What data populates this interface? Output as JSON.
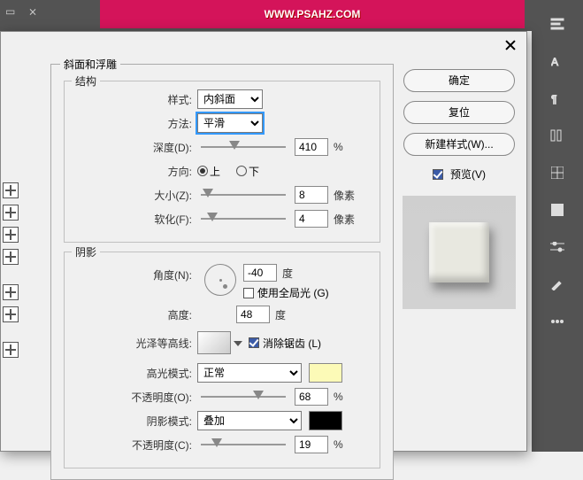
{
  "watermark": "WWW.PSAHZ.COM",
  "section": {
    "title": "斜面和浮雕",
    "structure": "结构",
    "shadow": "阴影"
  },
  "structure": {
    "style_label": "样式:",
    "style_value": "内斜面",
    "technique_label": "方法:",
    "technique_value": "平滑",
    "depth_label": "深度(D):",
    "depth_value": "410",
    "depth_unit": "%",
    "direction_label": "方向:",
    "dir_up": "上",
    "dir_down": "下",
    "size_label": "大小(Z):",
    "size_value": "8",
    "size_unit": "像素",
    "soften_label": "软化(F):",
    "soften_value": "4",
    "soften_unit": "像素"
  },
  "shadow": {
    "angle_label": "角度(N):",
    "angle_value": "-40",
    "angle_unit": "度",
    "global_label": "使用全局光 (G)",
    "altitude_label": "高度:",
    "altitude_value": "48",
    "altitude_unit": "度",
    "gloss_label": "光泽等高线:",
    "antialias_label": "消除锯齿 (L)",
    "hlmode_label": "高光模式:",
    "hlmode_value": "正常",
    "hlopacity_label": "不透明度(O):",
    "hlopacity_value": "68",
    "hlopacity_unit": "%",
    "shmode_label": "阴影模式:",
    "shmode_value": "叠加",
    "shopacity_label": "不透明度(C):",
    "shopacity_value": "19",
    "shopacity_unit": "%"
  },
  "buttons": {
    "ok": "确定",
    "reset": "复位",
    "newstyle": "新建样式(W)...",
    "preview": "预览(V)"
  }
}
